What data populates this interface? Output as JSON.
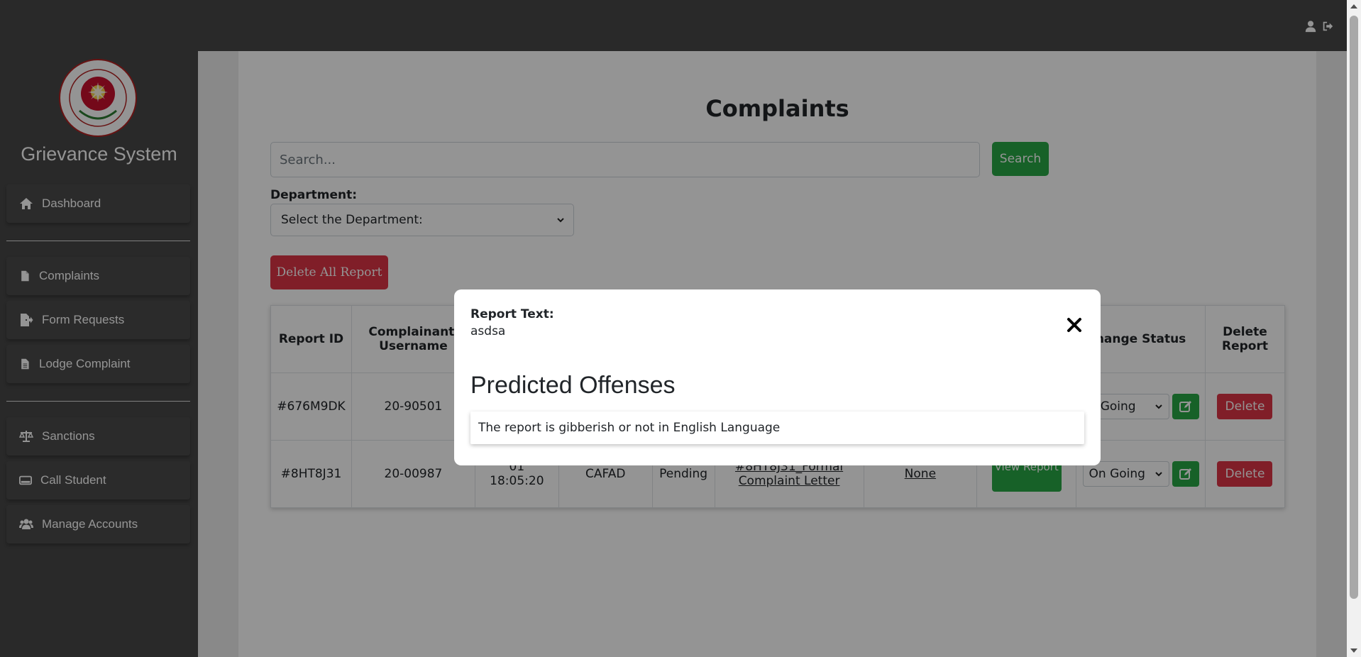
{
  "app": {
    "title": "Grievance System"
  },
  "topbar": {
    "icons": [
      "user-icon",
      "logout-icon"
    ]
  },
  "sidebar": {
    "items": [
      {
        "label": "Dashboard",
        "icon": "home-icon"
      },
      {
        "label": "Complaints",
        "icon": "file-icon"
      },
      {
        "label": "Form Requests",
        "icon": "file-export-icon"
      },
      {
        "label": "Lodge Complaint",
        "icon": "file-icon"
      },
      {
        "label": "Sanctions",
        "icon": "scale-icon"
      },
      {
        "label": "Call Student",
        "icon": "id-card-icon"
      },
      {
        "label": "Manage Accounts",
        "icon": "users-icon"
      }
    ]
  },
  "main": {
    "title": "Complaints",
    "search": {
      "placeholder": "Search...",
      "button": "Search"
    },
    "department": {
      "label": "Department:",
      "selected": "Select the Department:"
    },
    "delete_all": "Delete All Report",
    "table": {
      "headers": {
        "report_id": "Report ID",
        "username": "Complainant' Username",
        "change_status": "hange Status",
        "delete_report": "Delete Report"
      },
      "rows": [
        {
          "report_id": "#676M9DK",
          "username": "20-90501",
          "status_value": "n Going",
          "delete": "Delete"
        },
        {
          "report_id": "#8HT8J31",
          "username": "20-00987",
          "date": "01",
          "time": "18:05:20",
          "department": "CAFAD",
          "status": "Pending",
          "letter_top": "#8HT8J31_Formal",
          "letter_bottom": "Complaint Letter",
          "sanction": "None",
          "view": "View Report",
          "status_value": "On Going",
          "delete": "Delete"
        }
      ]
    }
  },
  "modal": {
    "report_text_label": "Report Text:",
    "report_text": "asdsa",
    "predicted_title": "Predicted Offenses",
    "offense": "The report is gibberish or not in English Language"
  },
  "colors": {
    "sidebar": "#474747",
    "success": "#28a745",
    "danger": "#dc3545",
    "overlay": "rgba(0,0,0,0.42)"
  }
}
